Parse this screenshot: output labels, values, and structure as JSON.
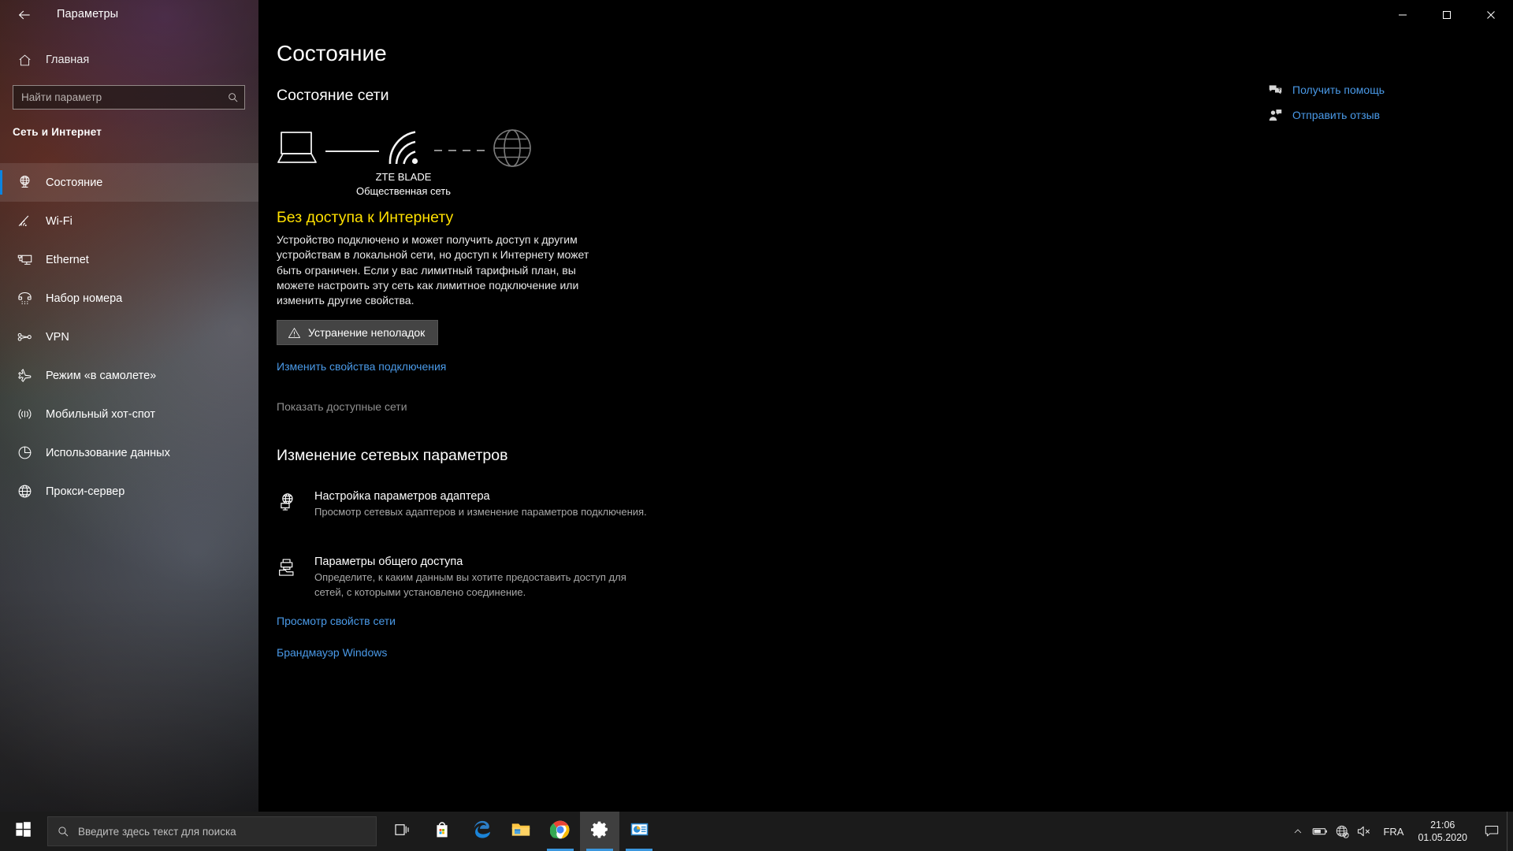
{
  "window": {
    "title": "Параметры",
    "back_icon": "back-arrow-icon",
    "minimize_icon": "minimize-icon",
    "maximize_icon": "maximize-icon",
    "close_icon": "close-icon"
  },
  "sidebar": {
    "home": {
      "label": "Главная",
      "icon": "home-icon"
    },
    "search": {
      "placeholder": "Найти параметр",
      "value": "",
      "icon": "search-icon"
    },
    "category": "Сеть и Интернет",
    "items": [
      {
        "label": "Состояние",
        "icon": "network-status-icon",
        "selected": true
      },
      {
        "label": "Wi-Fi",
        "icon": "wifi-icon",
        "selected": false
      },
      {
        "label": "Ethernet",
        "icon": "ethernet-icon",
        "selected": false
      },
      {
        "label": "Набор номера",
        "icon": "dialup-icon",
        "selected": false
      },
      {
        "label": "VPN",
        "icon": "vpn-icon",
        "selected": false
      },
      {
        "label": "Режим «в самолете»",
        "icon": "airplane-icon",
        "selected": false
      },
      {
        "label": "Мобильный хот-спот",
        "icon": "hotspot-icon",
        "selected": false
      },
      {
        "label": "Использование данных",
        "icon": "data-usage-icon",
        "selected": false
      },
      {
        "label": "Прокси-сервер",
        "icon": "proxy-icon",
        "selected": false
      }
    ]
  },
  "main": {
    "page_title": "Состояние",
    "network_status_heading": "Состояние сети",
    "diagram": {
      "device_icon": "laptop-icon",
      "connection_icon": "wifi-signal-icon",
      "internet_icon": "globe-icon",
      "network_name": "ZTE BLADE",
      "network_type": "Общественная сеть"
    },
    "status_title": "Без доступа к Интернету",
    "status_color": "#ffe000",
    "status_description": "Устройство подключено и может получить доступ к другим устройствам в локальной сети, но доступ к Интернету может быть ограничен. Если у вас лимитный тарифный план, вы можете настроить эту сеть как лимитное подключение или изменить другие свойства.",
    "troubleshoot_button": {
      "label": "Устранение неполадок",
      "icon": "warning-triangle-icon"
    },
    "change_properties_link": "Изменить свойства подключения",
    "show_networks_text": "Показать доступные сети",
    "change_settings_heading": "Изменение сетевых параметров",
    "options": [
      {
        "title": "Настройка параметров адаптера",
        "description": "Просмотр сетевых адаптеров и изменение параметров подключения.",
        "icon": "adapter-icon"
      },
      {
        "title": "Параметры общего доступа",
        "description": "Определите, к каким данным вы хотите предоставить доступ для сетей, с которыми установлено соединение.",
        "icon": "sharing-icon"
      }
    ],
    "network_props_link": "Просмотр свойств сети",
    "firewall_link": "Брандмауэр Windows"
  },
  "help": {
    "items": [
      {
        "label": "Получить помощь",
        "icon": "help-chat-icon"
      },
      {
        "label": "Отправить отзыв",
        "icon": "feedback-icon"
      }
    ]
  },
  "taskbar": {
    "start_icon": "windows-start-icon",
    "search": {
      "placeholder": "Введите здесь текст для поиска",
      "value": "",
      "icon": "search-icon"
    },
    "buttons": [
      {
        "name": "task-view",
        "icon": "task-view-icon",
        "active": false,
        "running": false
      },
      {
        "name": "microsoft-store",
        "icon": "store-icon",
        "active": false,
        "running": false
      },
      {
        "name": "microsoft-edge",
        "icon": "edge-icon",
        "active": false,
        "running": false
      },
      {
        "name": "file-explorer",
        "icon": "folder-icon",
        "active": false,
        "running": false
      },
      {
        "name": "google-chrome",
        "icon": "chrome-icon",
        "active": false,
        "running": true
      },
      {
        "name": "settings",
        "icon": "gear-icon",
        "active": true,
        "running": true
      },
      {
        "name": "powerpoint",
        "icon": "presentation-icon",
        "active": false,
        "running": true
      }
    ],
    "tray": {
      "overflow_icon": "chevron-up-icon",
      "battery_icon": "battery-icon",
      "network_icon": "globe-no-internet-icon",
      "volume_icon": "volume-muted-icon",
      "language": "FRA",
      "time": "21:06",
      "date": "01.05.2020",
      "action_center_icon": "action-center-icon"
    }
  }
}
